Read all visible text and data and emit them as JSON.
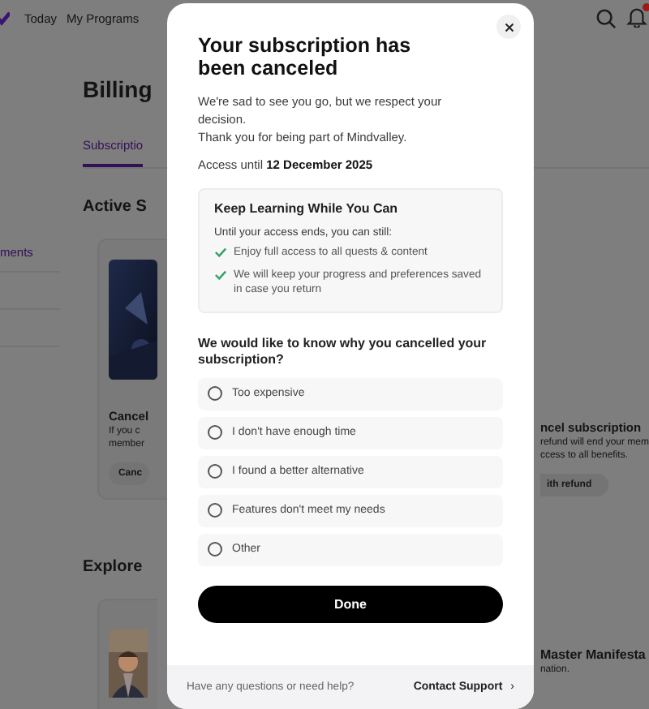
{
  "nav": {
    "items": [
      {
        "label": "Today"
      },
      {
        "label": "My Programs"
      }
    ],
    "notification_badge": true
  },
  "page": {
    "sidebar_item": "ments",
    "title": "Billing",
    "tabs": [
      {
        "label": "Subscriptio",
        "selected": true
      }
    ],
    "section_title": "Active S",
    "cancel_card": {
      "title": "Cancel",
      "text_lines": [
        "If you c",
        "member"
      ],
      "button": "Canc"
    },
    "refund_card": {
      "title": "ncel subscription",
      "text_lines": [
        "refund will end your mem",
        "ccess to all benefits."
      ],
      "button": "ith refund"
    },
    "explore_title": "Explore",
    "program_title": "Master Manifesta",
    "program_text": "nation."
  },
  "dialog": {
    "title": "Your subscription has been canceled",
    "message_lines": [
      "We're sad to see you go, but we respect your decision.",
      "Thank you for being part of Mindvalley."
    ],
    "access": "Access until **12 December 2025**",
    "keep_box": {
      "title": "Keep Learning While You Can",
      "subtitle": "Until your access ends, you can still:",
      "benefits": [
        "Enjoy full access to all quests & content",
        "We will keep your progress and preferences saved in case you return"
      ]
    },
    "question": "We would like to know why you cancelled your subscription?",
    "options": [
      {
        "label": "Too expensive",
        "selected": false
      },
      {
        "label": "I don't have enough time",
        "selected": false
      },
      {
        "label": "I found a better alternative",
        "selected": false
      },
      {
        "label": "Features don't meet my needs",
        "selected": false
      },
      {
        "label": "Other",
        "selected": false
      }
    ],
    "button": "Done",
    "footer": {
      "text": "Have any questions or need help?",
      "link": "Contact Support",
      "chevron": "›"
    }
  }
}
